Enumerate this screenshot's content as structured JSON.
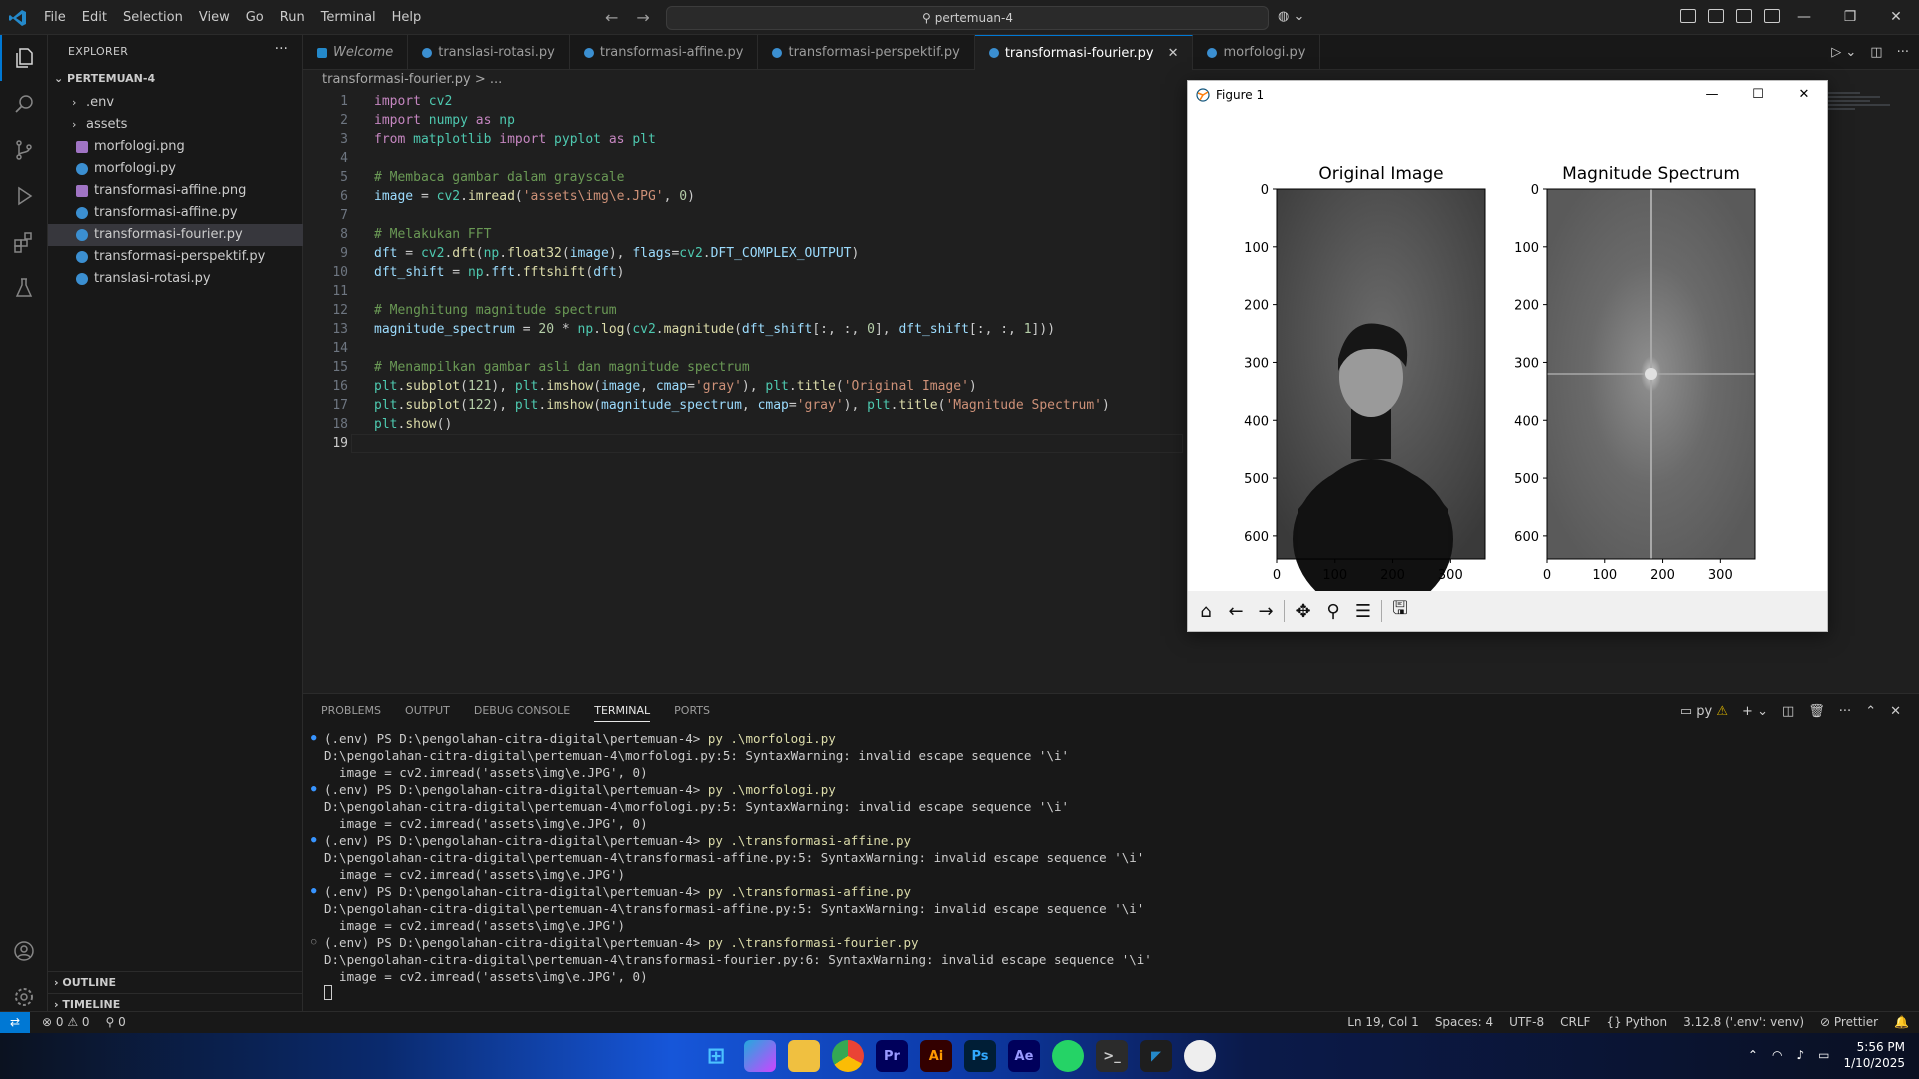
{
  "window": {
    "search": "pertemuan-4"
  },
  "menu": [
    "File",
    "Edit",
    "Selection",
    "View",
    "Go",
    "Run",
    "Terminal",
    "Help"
  ],
  "explorer": {
    "title": "EXPLORER",
    "folder": "PERTEMUAN-4",
    "items": [
      {
        "label": ".env",
        "type": "folder"
      },
      {
        "label": "assets",
        "type": "folder"
      },
      {
        "label": "morfologi.png",
        "type": "png"
      },
      {
        "label": "morfologi.py",
        "type": "py"
      },
      {
        "label": "transformasi-affine.png",
        "type": "png"
      },
      {
        "label": "transformasi-affine.py",
        "type": "py"
      },
      {
        "label": "transformasi-fourier.py",
        "type": "py",
        "selected": true
      },
      {
        "label": "transformasi-perspektif.py",
        "type": "py"
      },
      {
        "label": "translasi-rotasi.py",
        "type": "py"
      }
    ],
    "outline": "OUTLINE",
    "timeline": "TIMELINE"
  },
  "tabs": [
    "Welcome",
    "translasi-rotasi.py",
    "transformasi-affine.py",
    "transformasi-perspektif.py",
    "transformasi-fourier.py",
    "morfologi.py"
  ],
  "breadcrumb": "transformasi-fourier.py > ...",
  "code": {
    "l1": "import cv2",
    "l2": "import numpy as np",
    "l3": "from matplotlib import pyplot as plt",
    "l5": "# Membaca gambar dalam grayscale",
    "l6": "image = cv2.imread('assets\\img\\e.JPG', 0)",
    "l8": "# Melakukan FFT",
    "l9": "dft = cv2.dft(np.float32(image), flags=cv2.DFT_COMPLEX_OUTPUT)",
    "l10": "dft_shift = np.fft.fftshift(dft)",
    "l12": "# Menghitung magnitude spectrum",
    "l13": "magnitude_spectrum = 20 * np.log(cv2.magnitude(dft_shift[:, :, 0], dft_shift[:, :, 1]))",
    "l15": "# Menampilkan gambar asli dan magnitude spectrum",
    "l16": "plt.subplot(121), plt.imshow(image, cmap='gray'), plt.title('Original Image')",
    "l17": "plt.subplot(122), plt.imshow(magnitude_spectrum, cmap='gray'), plt.title('Magnitude Spectrum')",
    "l18": "plt.show()"
  },
  "panel": {
    "tabs": [
      "PROBLEMS",
      "OUTPUT",
      "DEBUG CONSOLE",
      "TERMINAL",
      "PORTS"
    ],
    "lines": [
      {
        "dot": "filled",
        "prompt": "(.env) PS D:\\pengolahan-citra-digital\\pertemuan-4> ",
        "cmd": "py .\\morfologi.py"
      },
      {
        "text": "D:\\pengolahan-citra-digital\\pertemuan-4\\morfologi.py:5: SyntaxWarning: invalid escape sequence '\\i'"
      },
      {
        "text": "  image = cv2.imread('assets\\img\\e.JPG', 0)"
      },
      {
        "dot": "filled",
        "prompt": "(.env) PS D:\\pengolahan-citra-digital\\pertemuan-4> ",
        "cmd": "py .\\morfologi.py"
      },
      {
        "text": "D:\\pengolahan-citra-digital\\pertemuan-4\\morfologi.py:5: SyntaxWarning: invalid escape sequence '\\i'"
      },
      {
        "text": "  image = cv2.imread('assets\\img\\e.JPG', 0)"
      },
      {
        "dot": "filled",
        "prompt": "(.env) PS D:\\pengolahan-citra-digital\\pertemuan-4> ",
        "cmd": "py .\\transformasi-affine.py"
      },
      {
        "text": "D:\\pengolahan-citra-digital\\pertemuan-4\\transformasi-affine.py:5: SyntaxWarning: invalid escape sequence '\\i'"
      },
      {
        "text": "  image = cv2.imread('assets\\img\\e.JPG')"
      },
      {
        "dot": "filled",
        "prompt": "(.env) PS D:\\pengolahan-citra-digital\\pertemuan-4> ",
        "cmd": "py .\\transformasi-affine.py"
      },
      {
        "text": "D:\\pengolahan-citra-digital\\pertemuan-4\\transformasi-affine.py:5: SyntaxWarning: invalid escape sequence '\\i'"
      },
      {
        "text": "  image = cv2.imread('assets\\img\\e.JPG')"
      },
      {
        "dot": "hollow",
        "prompt": "(.env) PS D:\\pengolahan-citra-digital\\pertemuan-4> ",
        "cmd": "py .\\transformasi-fourier.py"
      },
      {
        "text": "D:\\pengolahan-citra-digital\\pertemuan-4\\transformasi-fourier.py:6: SyntaxWarning: invalid escape sequence '\\i'"
      },
      {
        "text": "  image = cv2.imread('assets\\img\\e.JPG', 0)"
      }
    ]
  },
  "status": {
    "errors": "0",
    "warnings": "0",
    "ports": "0",
    "position": "Ln 19, Col 1",
    "spaces": "Spaces: 4",
    "encoding": "UTF-8",
    "eol": "CRLF",
    "language": "Python",
    "interpreter": "3.12.8 ('.env': venv)",
    "prettier": "Prettier"
  },
  "figure": {
    "title": "Figure 1",
    "subplot1": {
      "title": "Original Image"
    },
    "subplot2": {
      "title": "Magnitude Spectrum"
    },
    "y_ticks": [
      "0",
      "100",
      "200",
      "300",
      "400",
      "500",
      "600"
    ],
    "x_ticks": [
      "0",
      "100",
      "200",
      "300"
    ]
  },
  "taskbar": {
    "time": "5:56 PM",
    "date": "1/10/2025"
  },
  "colors": {
    "accent": "#0078d4",
    "editor_bg": "#1f1f1f",
    "sidebar_bg": "#181818"
  }
}
